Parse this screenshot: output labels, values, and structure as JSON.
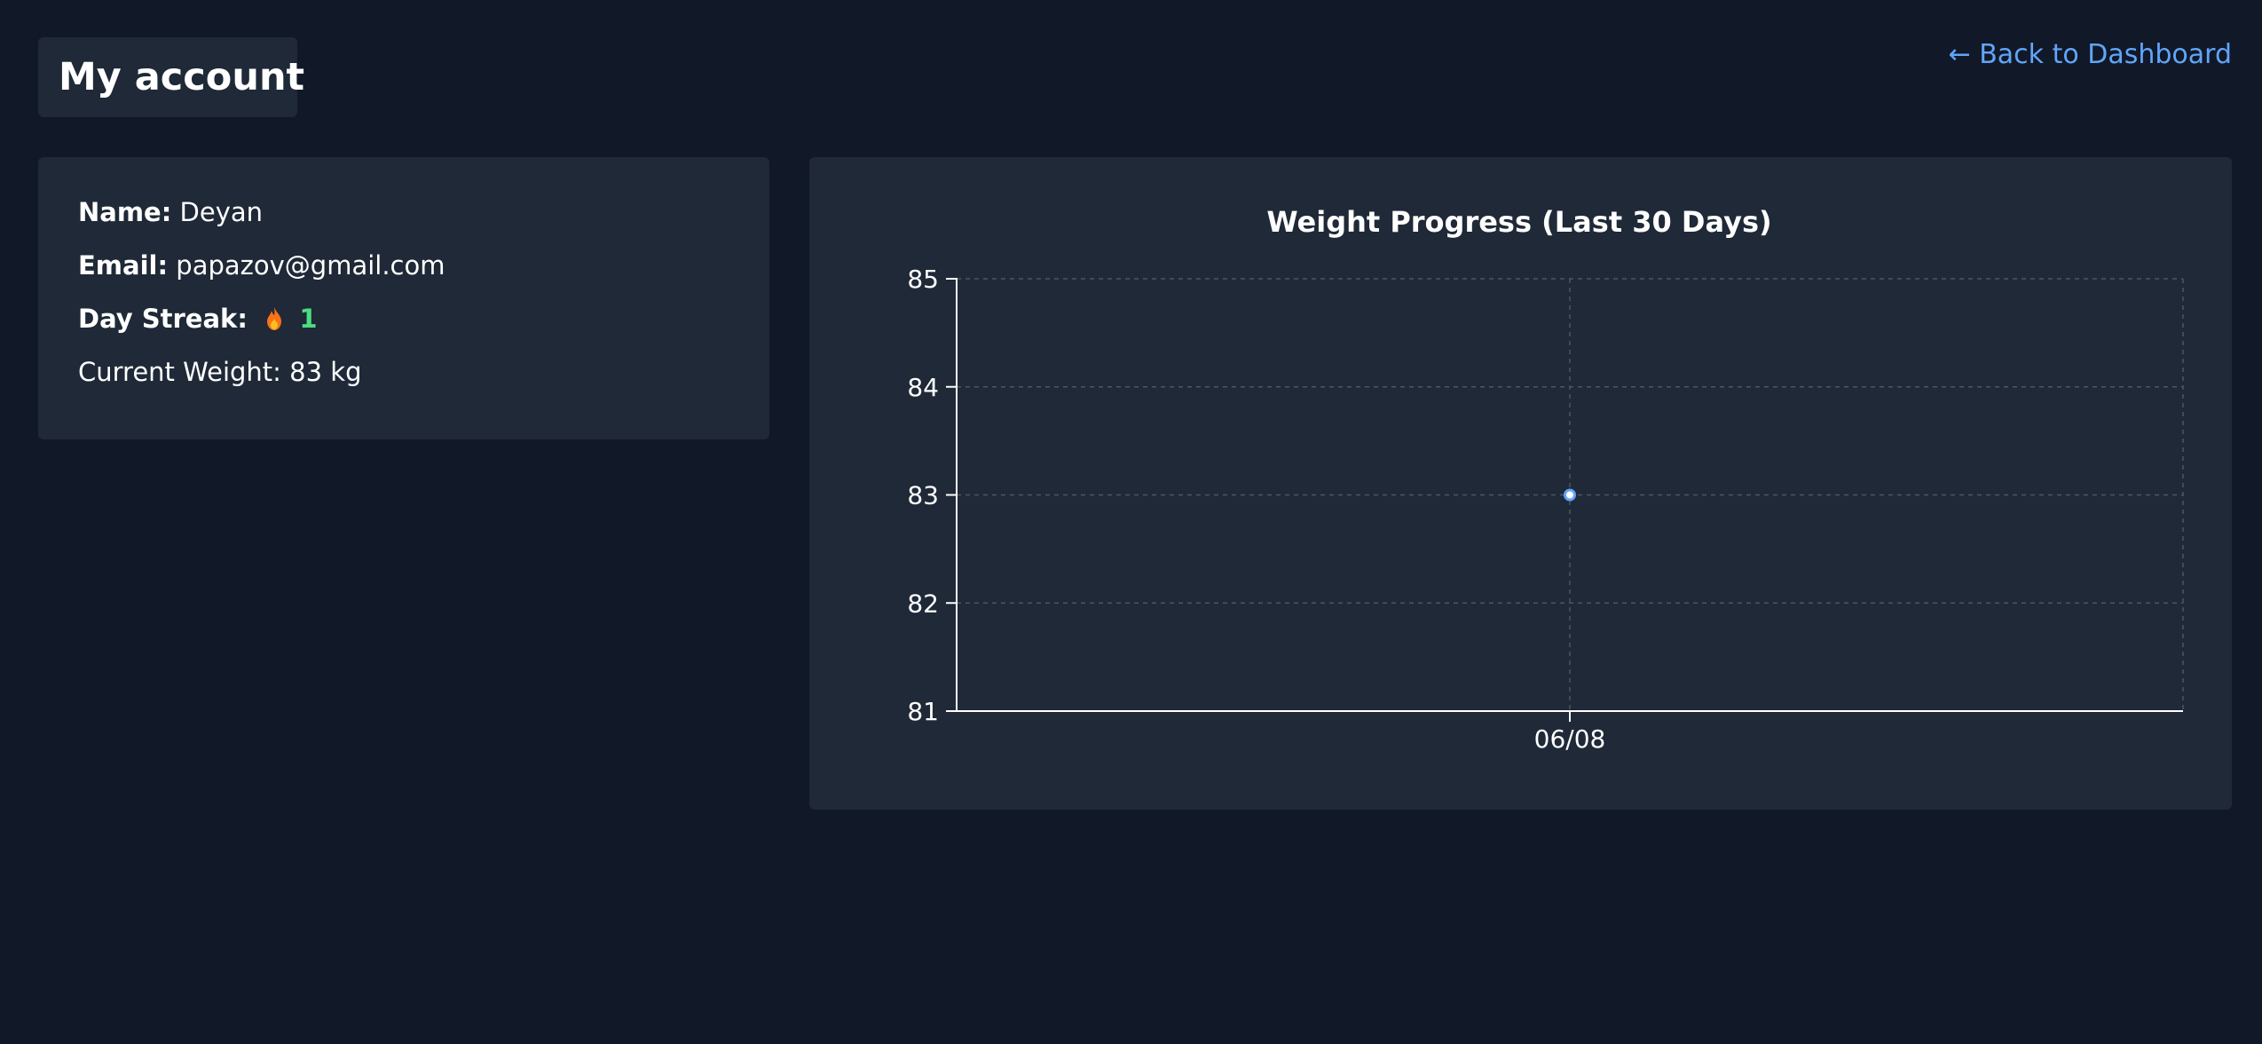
{
  "header": {
    "title": "My account",
    "back_link": "← Back to Dashboard"
  },
  "profile": {
    "name_label": "Name:",
    "name_value": "Deyan",
    "email_label": "Email:",
    "email_value": "papazov@gmail.com",
    "streak_label": "Day Streak:",
    "streak_icon": "fire-icon",
    "streak_value": "1",
    "weight_label": "Current Weight:",
    "weight_value": "83 kg"
  },
  "colors": {
    "background": "#111827",
    "card": "#1f2937",
    "link": "#60a5fa",
    "streak": "#4ade80",
    "point": "#60a5fa"
  },
  "chart_data": {
    "type": "scatter",
    "title": "Weight Progress (Last 30 Days)",
    "xlabel": "",
    "ylabel": "",
    "categories": [
      "06/08"
    ],
    "values": [
      83
    ],
    "ylim": [
      81,
      85
    ],
    "y_ticks": [
      81,
      82,
      83,
      84,
      85
    ],
    "grid": true
  }
}
